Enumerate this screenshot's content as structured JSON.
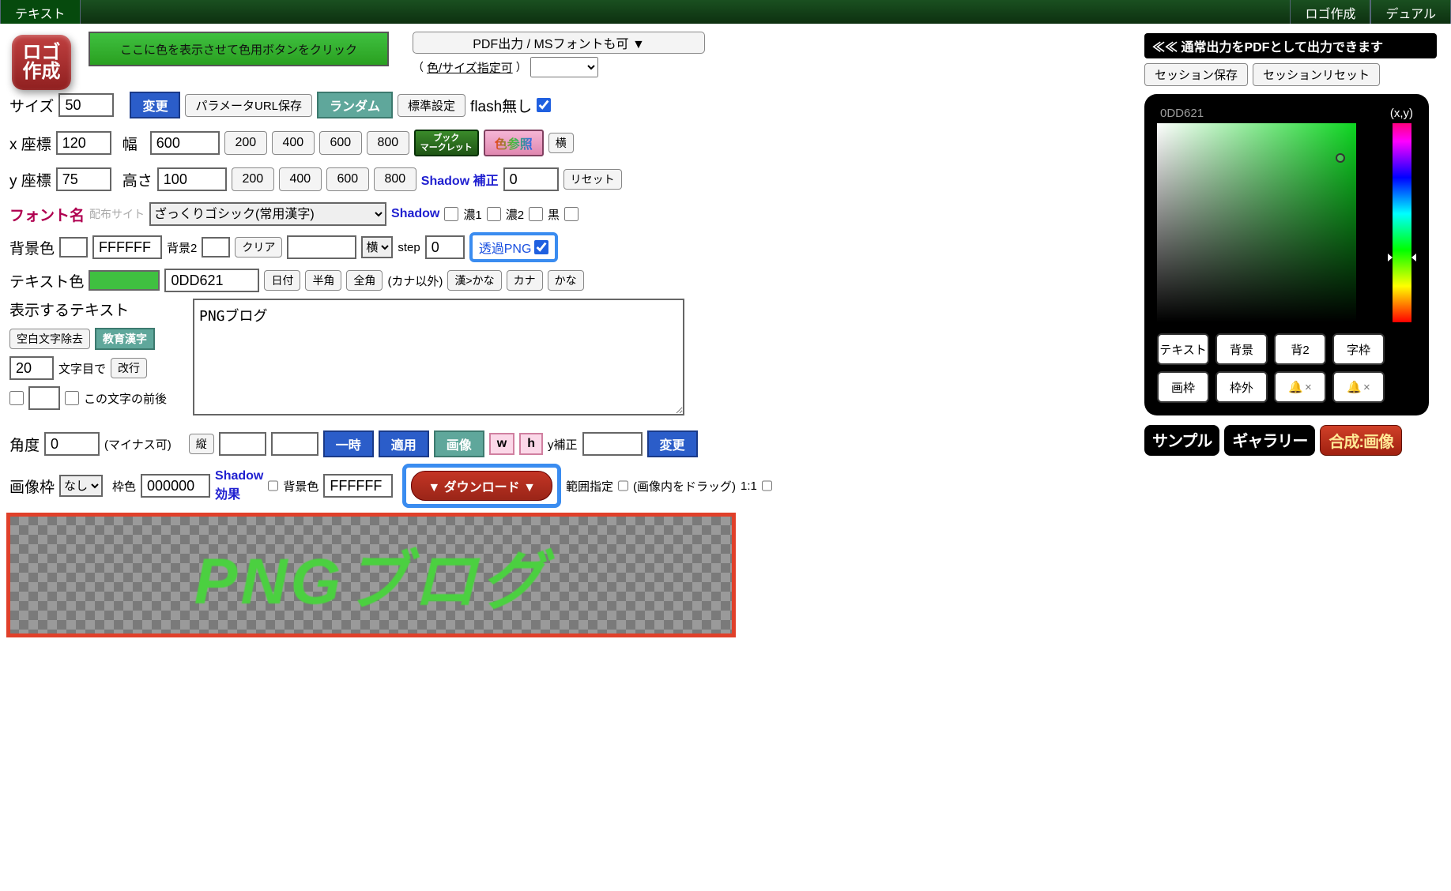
{
  "topbar": {
    "left_tab": "テキスト",
    "right_tab1": "ロゴ作成",
    "right_tab2": "デュアル"
  },
  "logo_badge": {
    "line1": "ロゴ",
    "line2": "作成"
  },
  "header": {
    "color_strip": "ここに色を表示させて色用ボタンをクリック",
    "pdf_button": "PDF出力 / MSフォントも可 ▼",
    "size_link_prefix": "（",
    "size_link": "色/サイズ指定可",
    "size_link_suffix": "）",
    "pdf_note": "≪≪ 通常出力をPDFとして出力できます",
    "session_save": "セッション保存",
    "session_reset": "セッションリセット"
  },
  "size": {
    "label": "サイズ",
    "value": "50",
    "change": "変更",
    "param_url": "パラメータURL保存",
    "random": "ランダム",
    "default": "標準設定",
    "flash": "flash無し",
    "flash_checked": true
  },
  "xcoord": {
    "label": "x 座標",
    "value": "120",
    "width_label": "幅",
    "width_value": "600",
    "presets": [
      "200",
      "400",
      "600",
      "800"
    ],
    "bookmarklet1": "ブック",
    "bookmarklet2": "マークレット",
    "colorref": "色参照",
    "yoko": "横"
  },
  "ycoord": {
    "label": "y 座標",
    "value": "75",
    "height_label": "高さ",
    "height_value": "100",
    "presets": [
      "200",
      "400",
      "600",
      "800"
    ],
    "shadow_corr": "Shadow 補正",
    "shadow_val": "0",
    "reset": "リセット"
  },
  "font": {
    "label": "フォント名",
    "site": "配布サイト",
    "selected": "ざっくりゴシック(常用漢字)",
    "shadow": "Shadow",
    "dark1": "濃1",
    "dark2": "濃2",
    "black": "黒"
  },
  "bg": {
    "label": "背景色",
    "hex": "FFFFFF",
    "bg2": "背景2",
    "clear": "クリア",
    "yoko": "横",
    "step": "step",
    "step_val": "0",
    "png": "透過PNG",
    "png_checked": true
  },
  "textcolor": {
    "label": "テキスト色",
    "hex": "0DD621",
    "date": "日付",
    "hankaku": "半角",
    "zenkaku": "全角",
    "kana_except": "(カナ以外)",
    "kan2kana": "漢>かな",
    "kana": "カナ",
    "kana2": "かな"
  },
  "textarea": {
    "label": "表示するテキスト",
    "value": "PNGブログ",
    "remove_space": "空白文字除去",
    "edu_kanji": "教育漢字",
    "wrap_at_val": "20",
    "wrap_at": "文字目で",
    "wrap_btn": "改行",
    "around": "この文字の前後"
  },
  "angle": {
    "label": "角度",
    "value": "0",
    "note": "(マイナス可)",
    "vertical": "縦",
    "temp": "一時",
    "apply": "適用",
    "image": "画像",
    "w": "w",
    "h": "h",
    "ycorr": "y補正",
    "ycorr_val": "",
    "change": "変更"
  },
  "frame": {
    "label": "画像枠",
    "none": "なし",
    "bordercolor": "枠色",
    "bordercolor_val": "000000",
    "shadow_effect": "Shadow 効果",
    "bgcolor": "背景色",
    "bgcolor_val": "FFFFFF",
    "download": "▼ ダウンロード ▼",
    "range": "範囲指定",
    "drag_note": "(画像内をドラッグ)",
    "ratio": "1:1"
  },
  "preview": {
    "text": "PNGブログ"
  },
  "picker": {
    "hex": "0DD621",
    "xy": "(x,y)",
    "btn_text": "テキスト",
    "btn_bg": "背景",
    "btn_bg2": "背2",
    "btn_glyph": "字枠",
    "btn_img": "画枠",
    "btn_out": "枠外",
    "mute": "×"
  },
  "pills": {
    "sample": "サンプル",
    "gallery": "ギャラリー",
    "composite": "合成:画像"
  }
}
